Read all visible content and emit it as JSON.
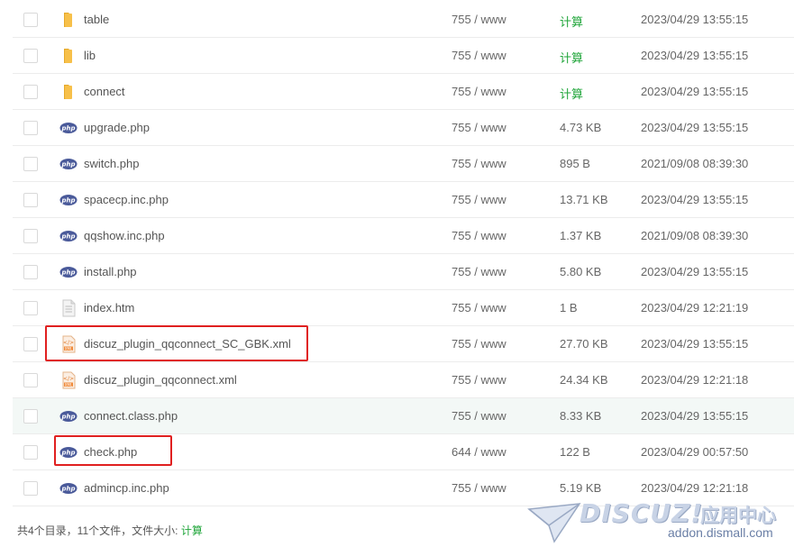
{
  "files": [
    {
      "name": "table",
      "type": "folder",
      "perm": "755 / www",
      "size": "计算",
      "size_is_calc": true,
      "mtime": "2023/04/29 13:55:15"
    },
    {
      "name": "lib",
      "type": "folder",
      "perm": "755 / www",
      "size": "计算",
      "size_is_calc": true,
      "mtime": "2023/04/29 13:55:15"
    },
    {
      "name": "connect",
      "type": "folder",
      "perm": "755 / www",
      "size": "计算",
      "size_is_calc": true,
      "mtime": "2023/04/29 13:55:15"
    },
    {
      "name": "upgrade.php",
      "type": "php",
      "perm": "755 / www",
      "size": "4.73 KB",
      "size_is_calc": false,
      "mtime": "2023/04/29 13:55:15"
    },
    {
      "name": "switch.php",
      "type": "php",
      "perm": "755 / www",
      "size": "895 B",
      "size_is_calc": false,
      "mtime": "2021/09/08 08:39:30"
    },
    {
      "name": "spacecp.inc.php",
      "type": "php",
      "perm": "755 / www",
      "size": "13.71 KB",
      "size_is_calc": false,
      "mtime": "2023/04/29 13:55:15"
    },
    {
      "name": "qqshow.inc.php",
      "type": "php",
      "perm": "755 / www",
      "size": "1.37 KB",
      "size_is_calc": false,
      "mtime": "2021/09/08 08:39:30"
    },
    {
      "name": "install.php",
      "type": "php",
      "perm": "755 / www",
      "size": "5.80 KB",
      "size_is_calc": false,
      "mtime": "2023/04/29 13:55:15"
    },
    {
      "name": "index.htm",
      "type": "htm",
      "perm": "755 / www",
      "size": "1 B",
      "size_is_calc": false,
      "mtime": "2023/04/29 12:21:19"
    },
    {
      "name": "discuz_plugin_qqconnect_SC_GBK.xml",
      "type": "xml",
      "perm": "755 / www",
      "size": "27.70 KB",
      "size_is_calc": false,
      "mtime": "2023/04/29 13:55:15"
    },
    {
      "name": "discuz_plugin_qqconnect.xml",
      "type": "xml",
      "perm": "755 / www",
      "size": "24.34 KB",
      "size_is_calc": false,
      "mtime": "2023/04/29 12:21:18"
    },
    {
      "name": "connect.class.php",
      "type": "php",
      "perm": "755 / www",
      "size": "8.33 KB",
      "size_is_calc": false,
      "mtime": "2023/04/29 13:55:15"
    },
    {
      "name": "check.php",
      "type": "php",
      "perm": "644 / www",
      "size": "122 B",
      "size_is_calc": false,
      "mtime": "2023/04/29 00:57:50"
    },
    {
      "name": "admincp.inc.php",
      "type": "php",
      "perm": "755 / www",
      "size": "5.19 KB",
      "size_is_calc": false,
      "mtime": "2023/04/29 12:21:18"
    }
  ],
  "icon_names": {
    "folder": "folder-icon",
    "php": "php-file-icon",
    "htm": "text-file-icon",
    "xml": "xml-file-icon"
  },
  "footer": {
    "summary": "共4个目录，11个文件，文件大小: ",
    "calc_link": "计算"
  },
  "watermark": {
    "brand": "DISCUZ!",
    "cn": "应用中心",
    "url": "addon.dismall.com"
  },
  "colors": {
    "calc_green": "#20a53a",
    "highlight_red": "#e02020",
    "php_badge": "#4a5a9a",
    "folder": "#f7c04a"
  }
}
